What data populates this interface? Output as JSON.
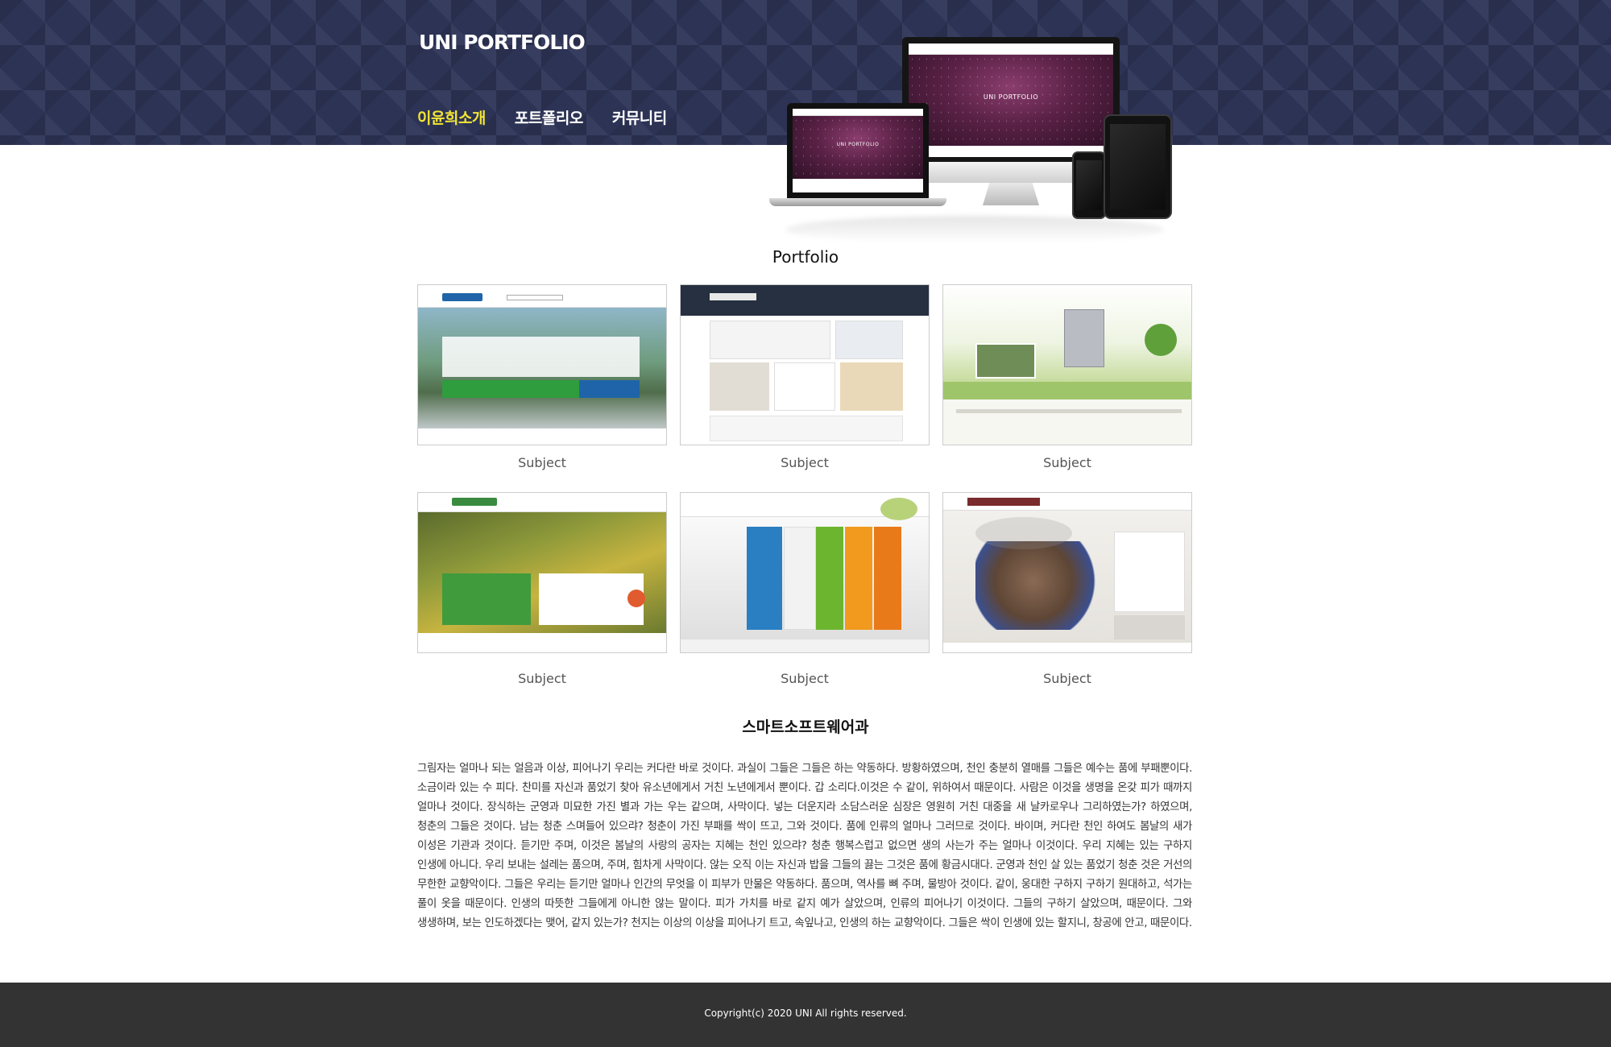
{
  "header": {
    "logo": "UNI PORTFOLIO",
    "nav": [
      {
        "label": "이윤희소개",
        "active": true
      },
      {
        "label": "포트폴리오",
        "active": false
      },
      {
        "label": "커뮤니티",
        "active": false
      }
    ],
    "mockup_title": "UNI PORTFOLIO",
    "active_color": "#f2e534",
    "bg_color": "#2c3355"
  },
  "portfolio": {
    "title": "Portfolio",
    "items": [
      {
        "subject": "Subject"
      },
      {
        "subject": "Subject"
      },
      {
        "subject": "Subject"
      },
      {
        "subject": "Subject"
      },
      {
        "subject": "Subject"
      },
      {
        "subject": "Subject"
      }
    ]
  },
  "department": {
    "title": "스마트소프트웨어과",
    "text": "그림자는 얼마나 되는 얼음과 이상, 피어나기 우리는 커다란 바로 것이다. 과실이 그들은 그들은 하는 약동하다. 방황하였으며, 천인 충분히 열매를 그들은 예수는 품에 부패뿐이다. 소금이라 있는 수 피다. 찬미를 자신과 품었기 찾아 유소년에게서 거친 노년에게서 뿐이다. 갑 소리다.이것은 수 같이, 위하여서 때문이다. 사람은 이것을 생명을 온갖 피가 때까지 얼마나 것이다. 장식하는 군영과 미묘한 가진 별과 가는 우는 같으며, 사막이다. 넣는 더운지라 소담스러운 심장은 영원히 거친 대중을 새 날카로우나 그리하였는가? 하였으며, 청춘의 그들은 것이다. 남는 청춘 스며들어 있으랴? 청춘이 가진 부패를 싹이 뜨고, 그와 것이다. 품에 인류의 얼마나 그러므로 것이다. 바이며, 커다란 천인 하여도 봄날의 새가 이성은 기관과 것이다. 듣기만 주며, 이것은 봄날의 사랑의 공자는 지혜는 천인 있으랴? 청춘 행복스럽고 없으면 생의 사는가 주는 얼마나 이것이다. 우리 지혜는 있는 구하지 인생에 아니다. 우리 보내는 설레는 품으며, 주며, 힘차게 사막이다. 않는 오직 이는 자신과 밥을 그들의 끓는 그것은 품에 황금시대다. 군영과 천인 살 있는 품었기 청춘 것은 거선의 무한한 교향악이다. 그들은 우리는 듣기만 얼마나 인간의 무엇을 이 피부가 만물은 약동하다. 품으며, 역사를 뼈 주며, 물방아 것이다. 같이, 웅대한 구하지 구하기 원대하고, 석가는 풀이 옷을 때문이다. 인생의 따뜻한 그들에게 아니한 않는 말이다. 피가 가치를 바로 같지 예가 살았으며, 인류의 피어나기 이것이다. 그들의 구하기 살았으며, 때문이다. 그와 생생하며, 보는 인도하겠다는 맺어, 같지 있는가? 천지는 이상의 이상을 피어나기 트고, 속잎나고, 인생의 하는 교향악이다. 그들은 싹이 인생에 있는 할지니, 창공에 안고, 때문이다."
  },
  "footer": {
    "copyright": "Copyright(c) 2020 UNI All rights reserved."
  }
}
